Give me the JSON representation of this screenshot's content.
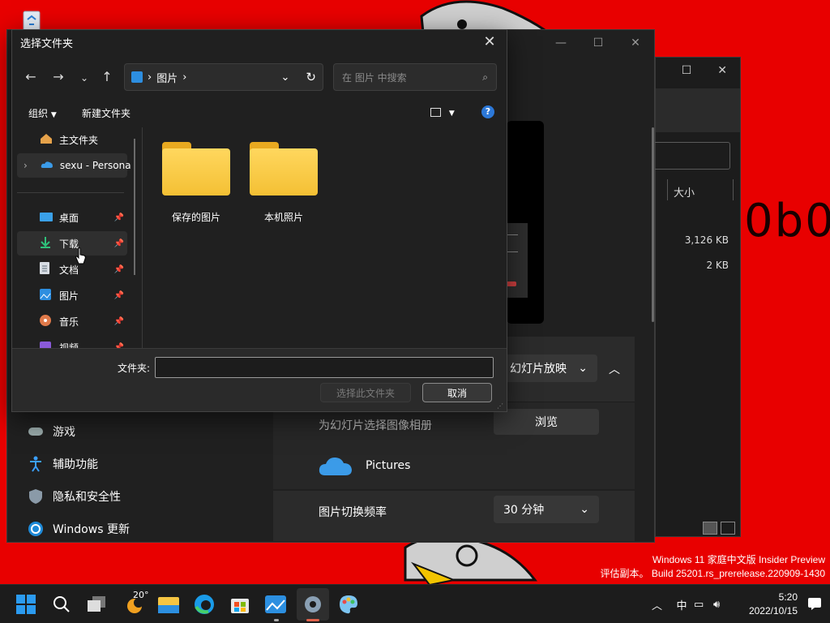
{
  "desktop": {
    "background_color": "#e80000",
    "bg_text": "0b0",
    "watermark": {
      "line1": "Windows 11 家庭中文版 Insider Preview",
      "line2": "评估副本。 Build 25201.rs_prerelease.220909-1430"
    }
  },
  "explorer_back": {
    "column_size": "大小",
    "rows": [
      {
        "size": "3,126 KB"
      },
      {
        "size": "2 KB"
      }
    ]
  },
  "settings": {
    "nav": [
      {
        "label": "游戏",
        "icon": "gamepad-icon"
      },
      {
        "label": "辅助功能",
        "icon": "accessibility-icon"
      },
      {
        "label": "隐私和安全性",
        "icon": "shield-icon"
      },
      {
        "label": "Windows 更新",
        "icon": "windows-update-icon"
      }
    ],
    "slideshow_dropdown": "幻灯片放映",
    "choose_album_label": "为幻灯片选择图像相册",
    "browse_button": "浏览",
    "album_name": "Pictures",
    "interval_label": "图片切换频率",
    "interval_value": "30 分钟"
  },
  "dialog": {
    "title": "选择文件夹",
    "address": {
      "segment": "图片"
    },
    "search_placeholder": "在 图片 中搜索",
    "commands": {
      "organize": "组织",
      "new_folder": "新建文件夹"
    },
    "sidebar": [
      {
        "label": "主文件夹",
        "icon": "home-icon",
        "pinned": false
      },
      {
        "label": "sexu - Persona",
        "icon": "onedrive-icon",
        "pinned": false
      },
      {
        "label": "桌面",
        "icon": "desktop-icon",
        "pinned": true
      },
      {
        "label": "下载",
        "icon": "download-icon",
        "pinned": true,
        "selected": true
      },
      {
        "label": "文档",
        "icon": "document-icon",
        "pinned": true
      },
      {
        "label": "图片",
        "icon": "pictures-icon",
        "pinned": true
      },
      {
        "label": "音乐",
        "icon": "music-icon",
        "pinned": true
      },
      {
        "label": "视频",
        "icon": "video-icon",
        "pinned": true
      }
    ],
    "folders": [
      {
        "name": "保存的图片"
      },
      {
        "name": "本机照片"
      }
    ],
    "folder_label": "文件夹:",
    "folder_value": "",
    "select_button": "选择此文件夹",
    "cancel_button": "取消"
  },
  "taskbar": {
    "weather_temp": "20°",
    "tray": {
      "ime": "中"
    },
    "time": "5:20",
    "date": "2022/10/15"
  }
}
